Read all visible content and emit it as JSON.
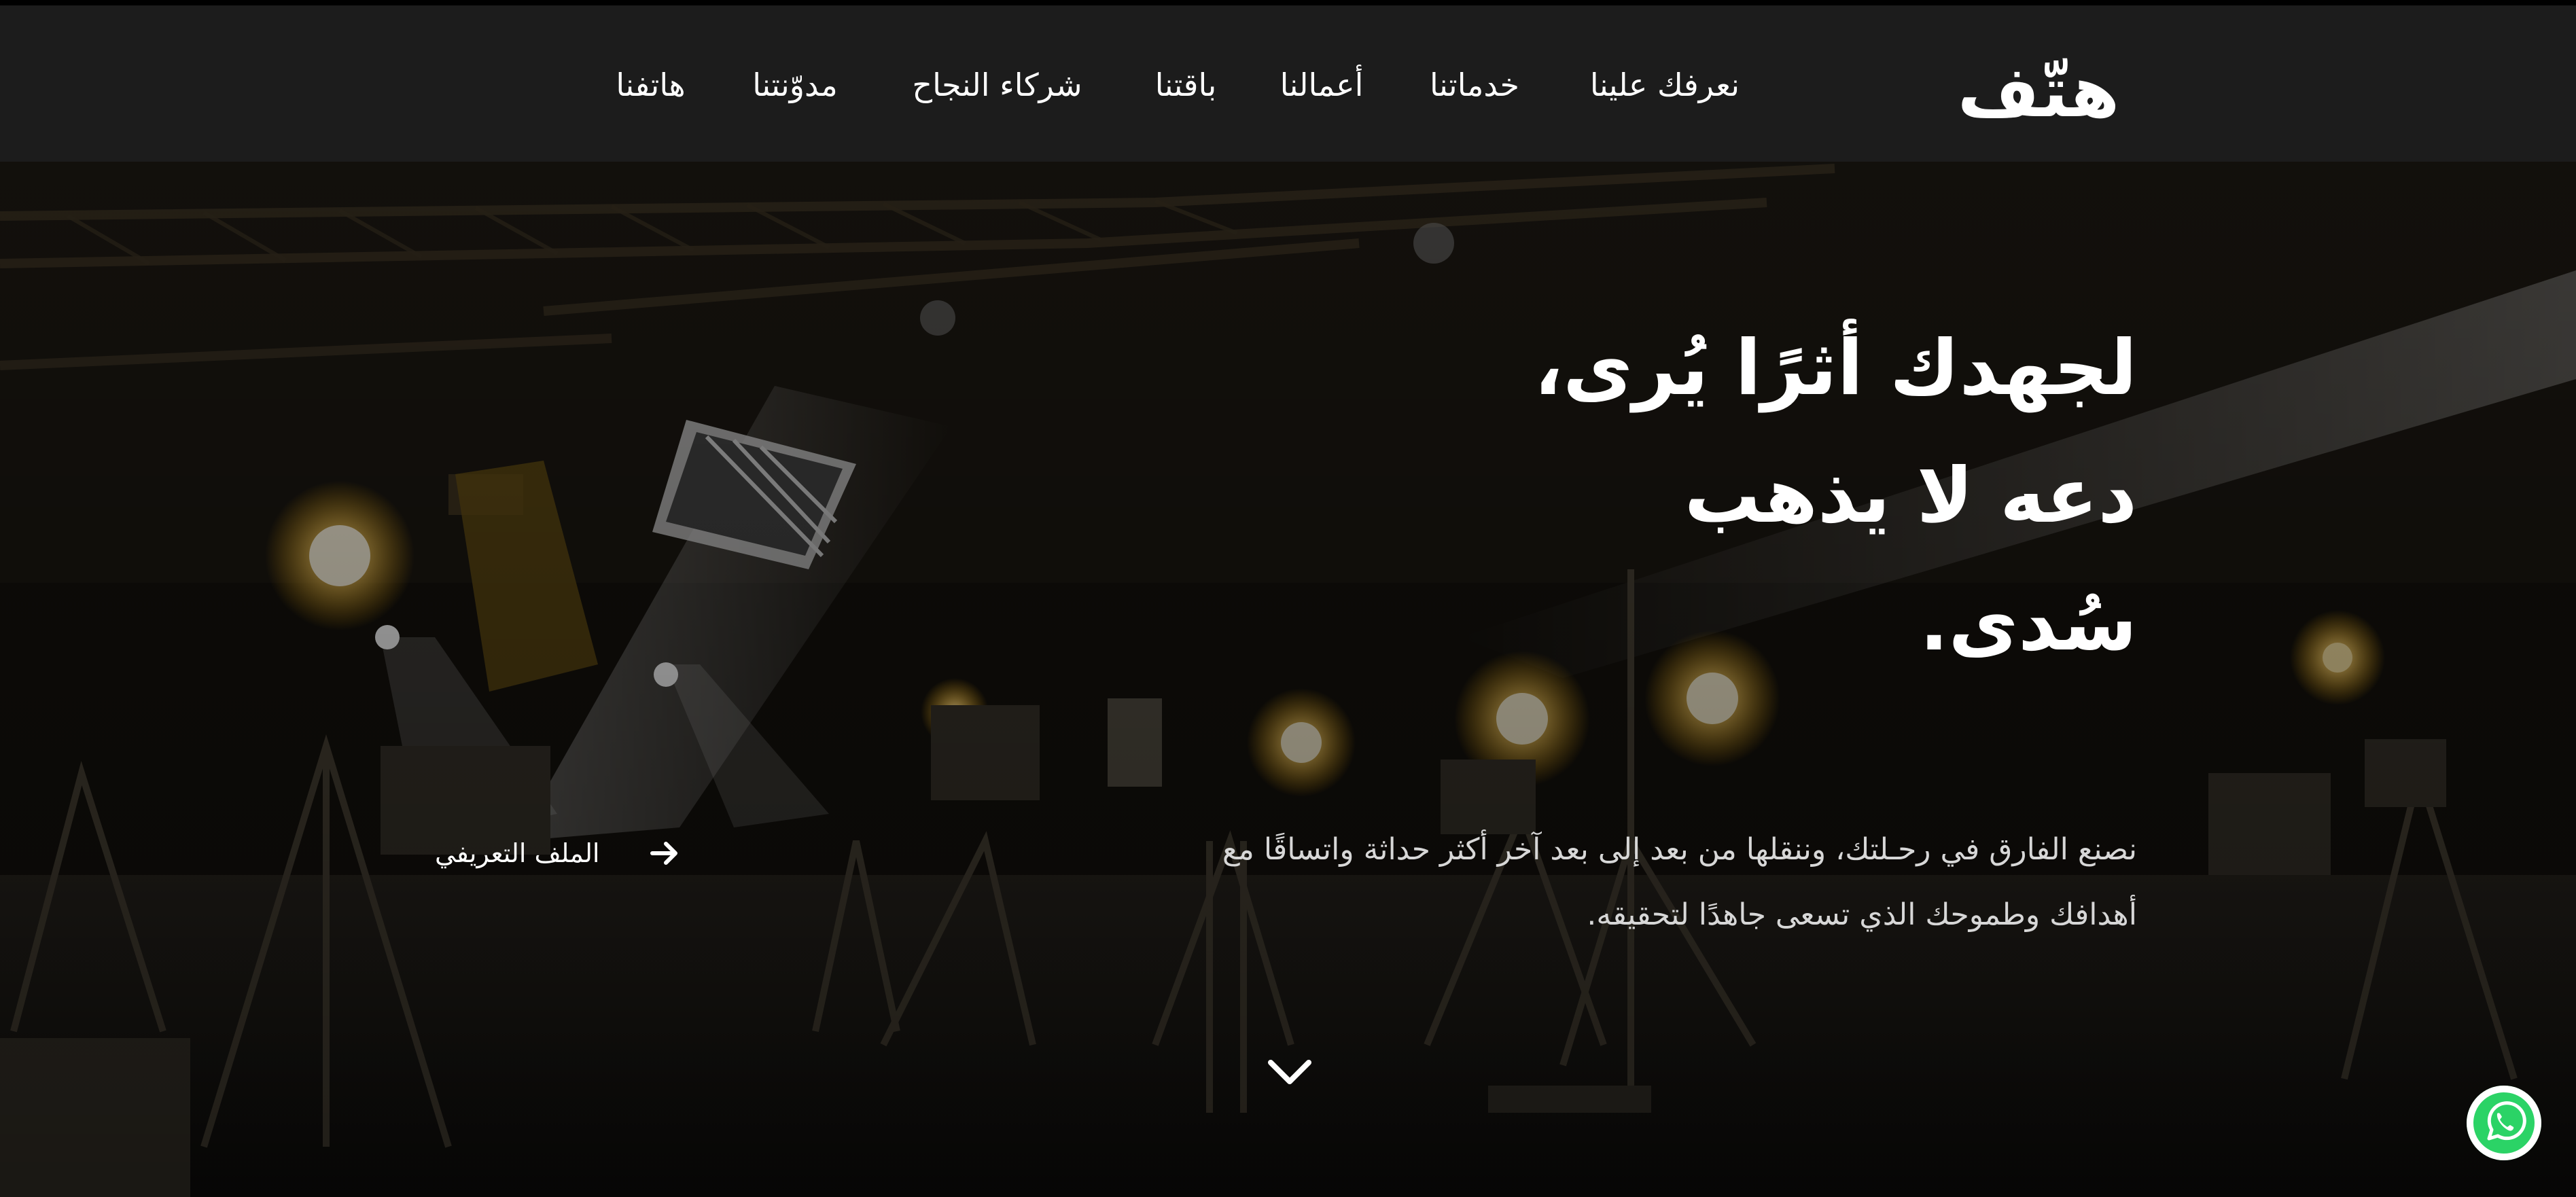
{
  "brand": {
    "logo_text": "هتّف"
  },
  "nav": {
    "items": [
      {
        "label": "نعرفك علينا"
      },
      {
        "label": "خدماتنا"
      },
      {
        "label": "أعمالنا"
      },
      {
        "label": "باقتنا"
      },
      {
        "label": "شركاء النجاح"
      },
      {
        "label": "مدوّنتنا"
      },
      {
        "label": "هاتفنا"
      }
    ]
  },
  "hero": {
    "headline_lines": [
      "لجهدك أثرًا يُرى،",
      "دعه لا يذهب",
      "سُدى."
    ],
    "subtext_lines": [
      "نصنع الفارق في رحـلتك، وننقلها من بعد إلى بعد آخر أكثر حداثة واتساقًا مع",
      "أهدافك وطموحك الذي تسعى جاهدًا لتحقيقه."
    ],
    "profile_link_label": "الملف التعريفي"
  },
  "icons": {
    "arrow": "arrow-right-icon",
    "scroll": "chevron-down-icon",
    "whatsapp": "whatsapp-icon"
  },
  "colors": {
    "header_bg": "#1c1c1c",
    "text": "#ffffff",
    "light_glow": "#ffd36b",
    "whatsapp_green": "#2bd366"
  }
}
